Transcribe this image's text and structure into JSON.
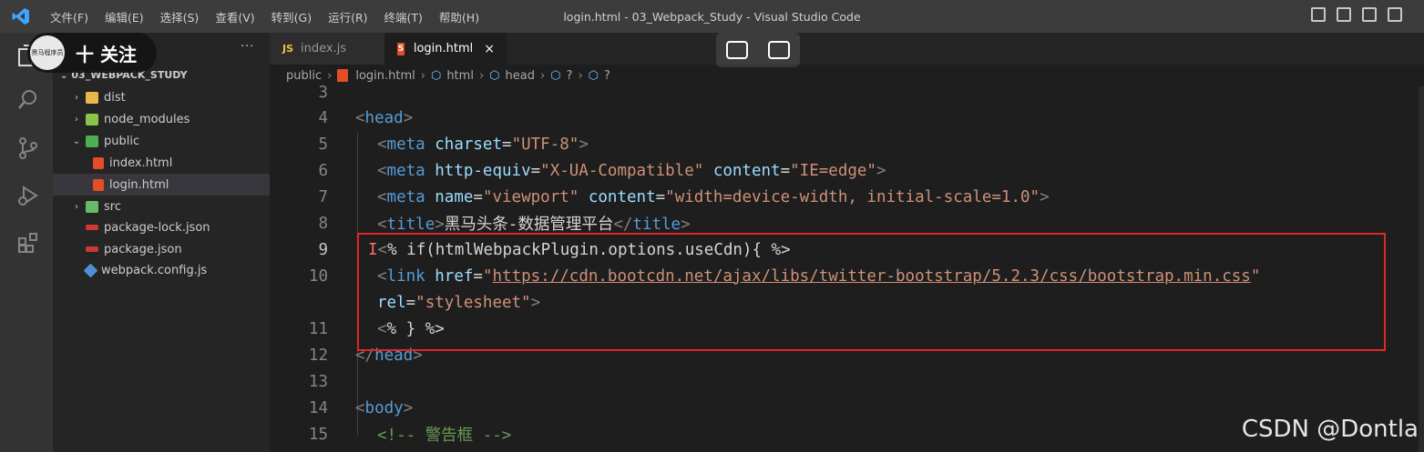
{
  "window": {
    "title": "login.html - 03_Webpack_Study - Visual Studio Code",
    "menu": [
      "文件(F)",
      "编辑(E)",
      "选择(S)",
      "查看(V)",
      "转到(G)",
      "运行(R)",
      "终端(T)",
      "帮助(H)"
    ]
  },
  "follow_overlay": {
    "label": "十 关注",
    "avatar_text": "黑马程序员"
  },
  "sidebar": {
    "more": "···",
    "root": "03_WEBPACK_STUDY",
    "items": [
      {
        "label": "dist",
        "chevron": "›",
        "icon_color": "#e8b94a"
      },
      {
        "label": "node_modules",
        "chevron": "›",
        "icon_color": "#8bc34a"
      },
      {
        "label": "public",
        "chevron": "⌄",
        "icon_color": "#4caf50"
      },
      {
        "label": "index.html",
        "chevron": "",
        "icon_color": "#e44d26"
      },
      {
        "label": "login.html",
        "chevron": "",
        "icon_color": "#e44d26"
      },
      {
        "label": "src",
        "chevron": "›",
        "icon_color": "#66bb6a"
      },
      {
        "label": "package-lock.json",
        "chevron": "",
        "icon_color": "#cb3837"
      },
      {
        "label": "package.json",
        "chevron": "",
        "icon_color": "#cb3837"
      },
      {
        "label": "webpack.config.js",
        "chevron": "",
        "icon_color": "#4f8fd8"
      }
    ]
  },
  "tabs": [
    {
      "badge": "JS",
      "label": "index.js"
    },
    {
      "badge": "5",
      "label": "login.html",
      "close": "×"
    }
  ],
  "breadcrumb": [
    "public",
    "login.html",
    "html",
    "head",
    "?",
    "?"
  ],
  "editor": {
    "lines": [
      {
        "num": "3"
      },
      {
        "num": "4"
      },
      {
        "num": "5"
      },
      {
        "num": "6"
      },
      {
        "num": "7"
      },
      {
        "num": "8"
      },
      {
        "num": "9"
      },
      {
        "num": "10"
      },
      {
        "num": ""
      },
      {
        "num": "11"
      },
      {
        "num": "12"
      },
      {
        "num": "13"
      },
      {
        "num": "14"
      },
      {
        "num": "15"
      }
    ],
    "t": {
      "lt": "<",
      "gt": ">",
      "lts": "</",
      "eq": "=",
      "head": "head",
      "meta": "meta",
      "title": "title",
      "link": "link",
      "body": "body",
      "charset": "charset",
      "utf8": "\"UTF-8\"",
      "httpequiv": "http-equiv",
      "xua": "\"X-UA-Compatible\"",
      "content": "content",
      "ie": "\"IE=edge\"",
      "name": "name",
      "viewport": "\"viewport\"",
      "vpc": "\"width=device-width, initial-scale=1.0\"",
      "title_text": "黑马头条-数据管理平台",
      "cursor": "I",
      "ejs_open": "% if(htmlWebpackPlugin.options.useCdn){ %>",
      "href": "href",
      "q": "\"",
      "url": "https://cdn.bootcdn.net/ajax/libs/twitter-bootstrap/5.2.3/css/bootstrap.min.css",
      "rel": "rel",
      "stylesheet": "\"stylesheet\"",
      "ejs_close": "% } %>",
      "comment": "<!-- 警告框 -->"
    }
  },
  "watermark": "CSDN @Dontla",
  "colors": {
    "highlight_box": "#e0262b",
    "keyword": "#569cd6",
    "attr": "#9cdcfe",
    "string": "#ce9178"
  }
}
